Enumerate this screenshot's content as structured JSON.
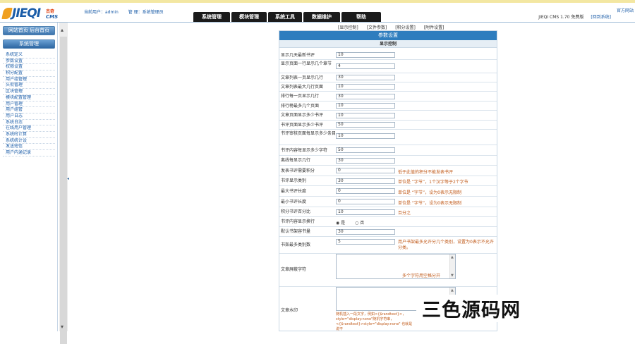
{
  "header": {
    "logo_text": "JIEQI",
    "logo_sub1": "杰奇",
    "logo_sub2": "CMS",
    "current_user": "当前用户：admin",
    "user_link": "管    理：系统管理员",
    "site_link": "官方网站",
    "nav_tabs": [
      "系统管理",
      "模块管理",
      "系统工具",
      "数据维护",
      "帮助"
    ],
    "version": "JIEQI CMS 1.70 免费版",
    "back_link": "[回到系统]"
  },
  "sidebar": {
    "home_button": "网站首页  后台首页",
    "mgmt_button": "系统管理",
    "items": [
      "系统定义",
      "参数设置",
      "权限设置",
      "积分配置",
      "用户组管理",
      "头衔管理",
      "区块管理",
      "模块配置管理",
      "用户管理",
      "用户组管",
      "用户日志",
      "系统日志",
      "在线用户管理",
      "系统时计算",
      "系统统计设",
      "发送短信",
      "用户内通记录"
    ]
  },
  "main": {
    "top_links": [
      "[显示控制]",
      "[文件参数]",
      "[积分设置]",
      "[附件设置]"
    ],
    "panel_title": "参数设置",
    "section_title": "显示控制",
    "rows": [
      {
        "label": "显示几天最新书评",
        "value": "10",
        "hint": ""
      },
      {
        "label": "显示页面一行显示几个章节",
        "value": "4",
        "hint": ""
      },
      {
        "label": "文章列表一页显示几行",
        "value": "30",
        "hint": ""
      },
      {
        "label": "文章列表最大几行页面",
        "value": "10",
        "hint": ""
      },
      {
        "label": "排行每一页显示几行",
        "value": "30",
        "hint": ""
      },
      {
        "label": "排行榜最多几个页面",
        "value": "10",
        "hint": ""
      },
      {
        "label": "文章页面显示多少书评",
        "value": "10",
        "hint": ""
      },
      {
        "label": "书评页面显示多少书评",
        "value": "50",
        "hint": ""
      },
      {
        "label": "书评审核页面每显示多少条目",
        "value": "10",
        "hint": ""
      },
      {
        "label": "书评内容每显示多少字符",
        "value": "50",
        "hint": ""
      },
      {
        "label": "离线每显示几行",
        "value": "30",
        "hint": ""
      },
      {
        "label": "发表书评需要积分",
        "value": "0",
        "hint": "低于此值的积分不能发表书评"
      },
      {
        "label": "书评显示类别",
        "value": "30",
        "hint": "单位是 “字节”，1个汉字等于2个字节"
      },
      {
        "label": "最大书评长度",
        "value": "0",
        "hint": "单位是 “字节”，设为0表示无限制"
      },
      {
        "label": "最小书评长度",
        "value": "0",
        "hint": "单位是 “字节”，设为0表示无限制"
      },
      {
        "label": "积分书评百分比",
        "value": "10",
        "hint": "百分之"
      },
      {
        "label": "书评内容显示换行",
        "value": "",
        "hint": ""
      },
      {
        "label": "默认书架容书量",
        "value": "30",
        "hint": ""
      },
      {
        "label": "书架最多类别数",
        "value": "5",
        "hint": "用户书架最多允许分几个类别，设置为0表示不允许分类。"
      }
    ],
    "radio_yes": "是",
    "radio_no": "否",
    "textarea1_label": "文章屏蔽字符",
    "textarea1_hint": "多个字符用空格分开",
    "textarea2_label": "文章水印",
    "textarea2_hint": "随机插入一段文字，例如<{$randtext}>，style=\"display:none\"随机字符串，<{$randtext}>style=\"display:none\" 也就是说不"
  },
  "watermark": "三色源码网"
}
